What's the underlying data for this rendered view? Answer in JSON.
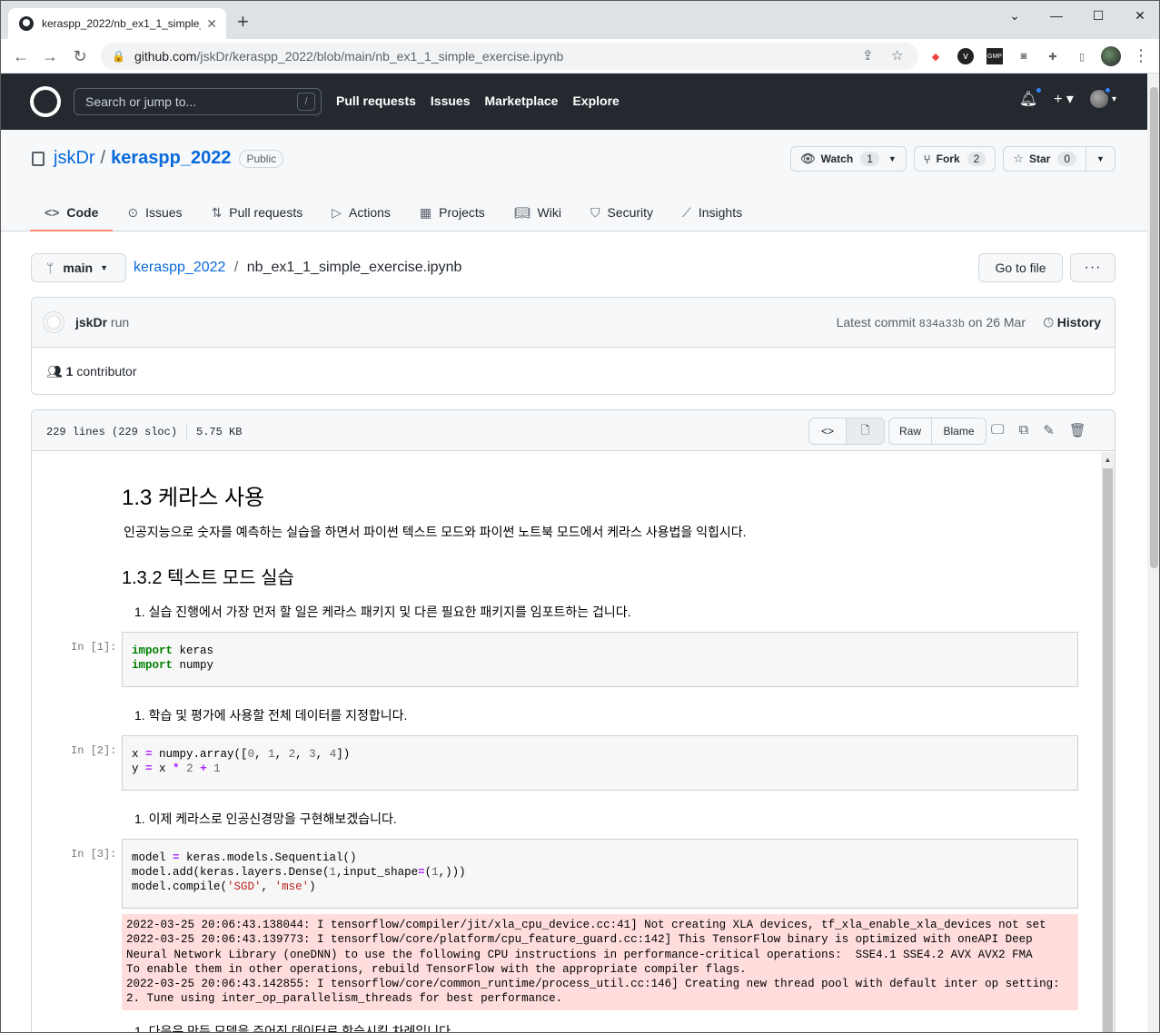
{
  "browser": {
    "tab_title": "keraspp_2022/nb_ex1_1_simple_",
    "url_host": "github.com",
    "url_path": "/jskDr/keraspp_2022/blob/main/nb_ex1_1_simple_exercise.ipynb"
  },
  "header": {
    "search_placeholder": "Search or jump to...",
    "slash": "/",
    "nav": [
      "Pull requests",
      "Issues",
      "Marketplace",
      "Explore"
    ]
  },
  "repo": {
    "owner": "jskDr",
    "name": "keraspp_2022",
    "visibility": "Public",
    "watch_label": "Watch",
    "watch_count": "1",
    "fork_label": "Fork",
    "fork_count": "2",
    "star_label": "Star",
    "star_count": "0",
    "tabs": [
      "Code",
      "Issues",
      "Pull requests",
      "Actions",
      "Projects",
      "Wiki",
      "Security",
      "Insights"
    ]
  },
  "filenav": {
    "branch": "main",
    "crumb_repo": "keraspp_2022",
    "crumb_file": "nb_ex1_1_simple_exercise.ipynb",
    "go_to_file": "Go to file",
    "more": "···"
  },
  "commit": {
    "author": "jskDr",
    "message": "run",
    "latest_label": "Latest commit",
    "sha": "834a33b",
    "date": "on 26 Mar",
    "history": "History",
    "contributors": "1",
    "contributors_label": "contributor"
  },
  "file": {
    "lines": "229 lines (229 sloc)",
    "size": "5.75 KB",
    "raw": "Raw",
    "blame": "Blame"
  },
  "notebook": {
    "h1": "1.3 케라스 사용",
    "intro": "인공지능으로 숫자를 예측하는 실습을 하면서 파이썬 텍스트 모드와 파이썬 노트북 모드에서 케라스 사용법을 익힙시다.",
    "h2": "1.3.2 텍스트 모드 실습",
    "step1": "1. 실습 진행에서 가장 먼저 할 일은 케라스 패키지 및 다른 필요한 패키지를 임포트하는 겁니다.",
    "prompt1": "In [1]:",
    "step2": "1. 학습 및 평가에 사용할 전체 데이터를 지정합니다.",
    "prompt2": "In [2]:",
    "step3": "1. 이제 케라스로 인공신경망을 구현해보겠습니다.",
    "prompt3": "In [3]:",
    "stderr": "2022-03-25 20:06:43.138044: I tensorflow/compiler/jit/xla_cpu_device.cc:41] Not creating XLA devices, tf_xla_enable_xla_devices not set\n2022-03-25 20:06:43.139773: I tensorflow/core/platform/cpu_feature_guard.cc:142] This TensorFlow binary is optimized with oneAPI Deep Neural Network Library (oneDNN) to use the following CPU instructions in performance-critical operations:  SSE4.1 SSE4.2 AVX AVX2 FMA\nTo enable them in other operations, rebuild TensorFlow with the appropriate compiler flags.\n2022-03-25 20:06:43.142855: I tensorflow/core/common_runtime/process_util.cc:146] Creating new thread pool with default inter op setting: 2. Tune using inter_op_parallelism_threads for best performance.",
    "step4": "1. 다음은 만든 모델을 주어진 데이터로 학습시킬 차례입니다."
  }
}
